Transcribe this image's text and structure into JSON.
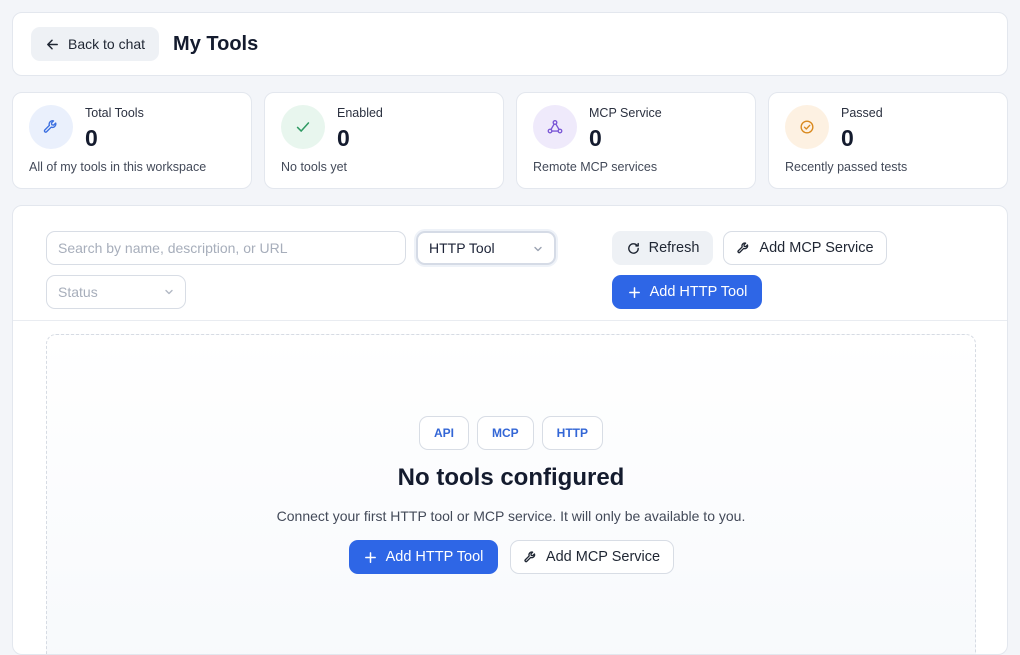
{
  "header": {
    "back_label": "Back to chat",
    "title": "My Tools"
  },
  "stats": [
    {
      "label": "Total Tools",
      "value": "0",
      "desc": "All of my tools in this workspace",
      "icon": "wrench-icon",
      "color": "#3b6fe0",
      "bg": "#eaf0fc"
    },
    {
      "label": "Enabled",
      "value": "0",
      "desc": "No tools yet",
      "icon": "check-icon",
      "color": "#2f9a63",
      "bg": "#e8f6ee"
    },
    {
      "label": "MCP Service",
      "value": "0",
      "desc": "Remote MCP services",
      "icon": "network-icon",
      "color": "#7b58d6",
      "bg": "#efeafb"
    },
    {
      "label": "Passed",
      "value": "0",
      "desc": "Recently passed tests",
      "icon": "badge-check-icon",
      "color": "#d9891e",
      "bg": "#fdf1e2"
    }
  ],
  "filters": {
    "search_placeholder": "Search by name, description, or URL",
    "search_value": "",
    "type_value": "HTTP Tool",
    "status_placeholder": "Status"
  },
  "toolbar": {
    "refresh_label": "Refresh",
    "add_mcp_label": "Add MCP Service",
    "add_http_label": "Add HTTP Tool"
  },
  "empty_state": {
    "chips": [
      "API",
      "MCP",
      "HTTP"
    ],
    "title": "No tools configured",
    "description": "Connect your first HTTP tool or MCP service. It will only be available to you.",
    "add_http_label": "Add HTTP Tool",
    "add_mcp_label": "Add MCP Service"
  },
  "colors": {
    "accent": "#2e66e6",
    "chip_text": "#3366d6"
  }
}
